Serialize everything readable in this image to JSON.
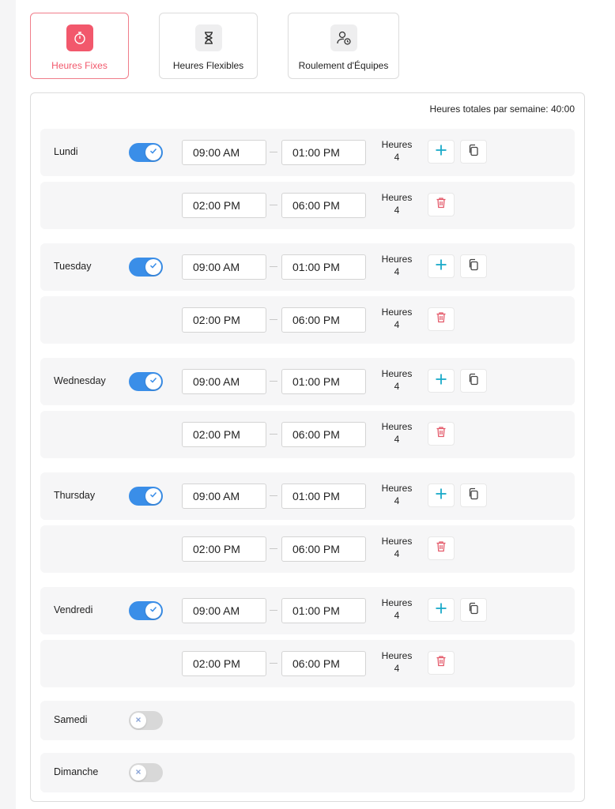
{
  "tabs": [
    {
      "label": "Heures Fixes",
      "icon": "timer-icon",
      "active": true
    },
    {
      "label": "Heures Flexibles",
      "icon": "hourglass-icon",
      "active": false
    },
    {
      "label": "Roulement d'Équipes",
      "icon": "user-clock-icon",
      "active": false
    }
  ],
  "total_hours": "Heures totales par semaine: 40:00",
  "hours_label": "Heures",
  "colors": {
    "accent": "#f2586c",
    "toggle_on": "#3a8ee8",
    "add": "#1aa9c9",
    "delete": "#e45a6a"
  },
  "days": [
    {
      "name": "Lundi",
      "enabled": true,
      "slots": [
        {
          "start": "09:00 AM",
          "end": "01:00 PM",
          "hours": "4"
        },
        {
          "start": "02:00 PM",
          "end": "06:00 PM",
          "hours": "4"
        }
      ]
    },
    {
      "name": "Tuesday",
      "enabled": true,
      "slots": [
        {
          "start": "09:00 AM",
          "end": "01:00 PM",
          "hours": "4"
        },
        {
          "start": "02:00 PM",
          "end": "06:00 PM",
          "hours": "4"
        }
      ]
    },
    {
      "name": "Wednesday",
      "enabled": true,
      "slots": [
        {
          "start": "09:00 AM",
          "end": "01:00 PM",
          "hours": "4"
        },
        {
          "start": "02:00 PM",
          "end": "06:00 PM",
          "hours": "4"
        }
      ]
    },
    {
      "name": "Thursday",
      "enabled": true,
      "slots": [
        {
          "start": "09:00 AM",
          "end": "01:00 PM",
          "hours": "4"
        },
        {
          "start": "02:00 PM",
          "end": "06:00 PM",
          "hours": "4"
        }
      ]
    },
    {
      "name": "Vendredi",
      "enabled": true,
      "slots": [
        {
          "start": "09:00 AM",
          "end": "01:00 PM",
          "hours": "4"
        },
        {
          "start": "02:00 PM",
          "end": "06:00 PM",
          "hours": "4"
        }
      ]
    },
    {
      "name": "Samedi",
      "enabled": false,
      "slots": []
    },
    {
      "name": "Dimanche",
      "enabled": false,
      "slots": []
    }
  ]
}
